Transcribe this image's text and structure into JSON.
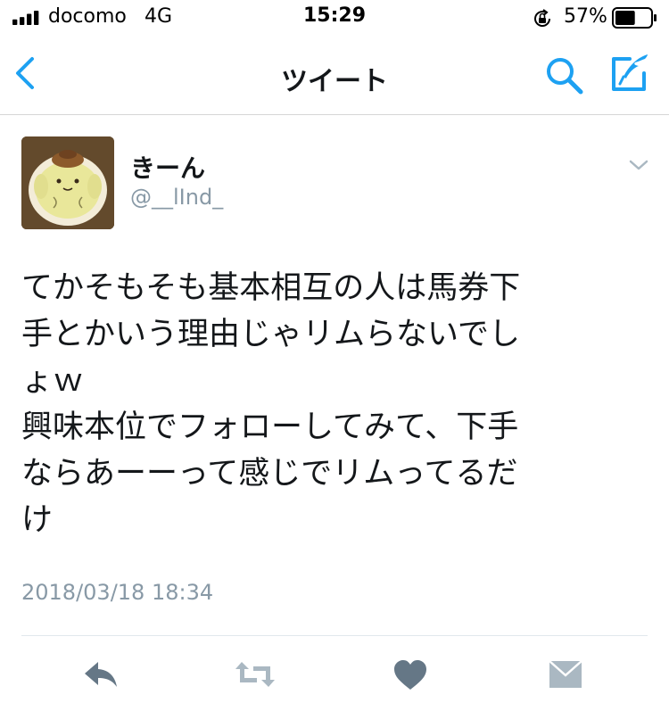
{
  "status_bar": {
    "carrier": "docomo",
    "network": "4G",
    "time": "15:29",
    "battery_percent": "57%",
    "battery_level": 0.57,
    "icons": [
      "signal-bars",
      "orientation-lock",
      "battery"
    ]
  },
  "nav": {
    "title": "ツイート",
    "icons": [
      "back-chevron",
      "search",
      "compose-tweet"
    ],
    "accent_color": "#1da1f2"
  },
  "tweet": {
    "display_name": "きーん",
    "handle": "@__lInd_",
    "text": "てかそもそも基本相互の人は馬券下\n手とかいう理由じゃリムらないでし\nょｗ\n興味本位でフォローしてみて、下手\nならあーーって感じでリムってるだ\nけ",
    "timestamp": "2018/03/18 18:34",
    "actions": [
      "reply",
      "retweet",
      "like",
      "direct-message"
    ],
    "action_color": "#657786"
  }
}
